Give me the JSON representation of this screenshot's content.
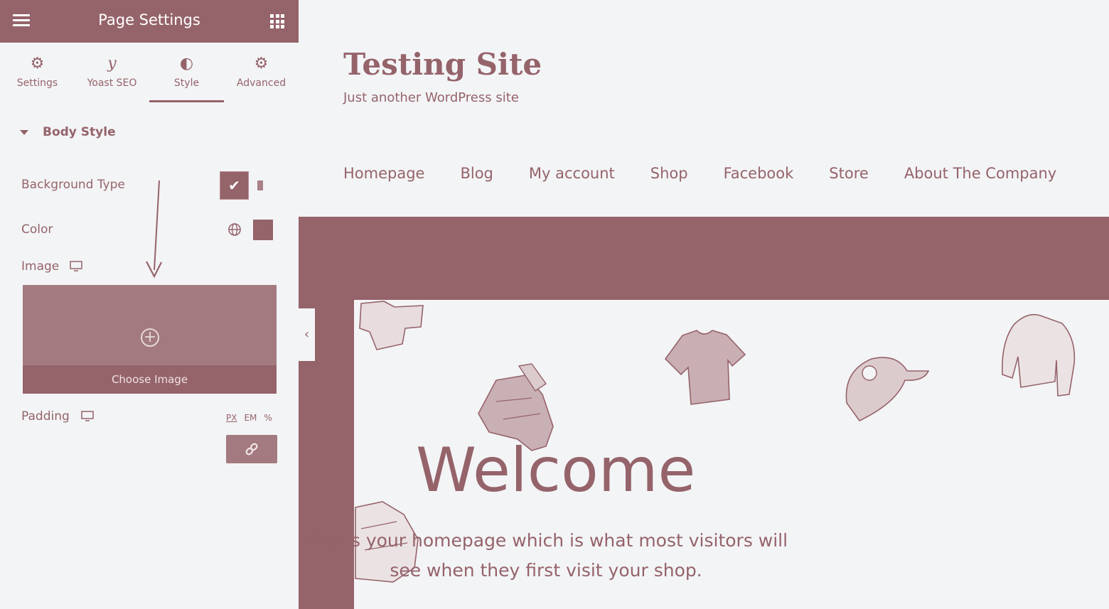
{
  "panel": {
    "title": "Page Settings",
    "tabs": [
      {
        "label": "Settings",
        "icon": "gear-icon"
      },
      {
        "label": "Yoast SEO",
        "icon": "yoast-icon"
      },
      {
        "label": "Style",
        "icon": "contrast-icon",
        "active": true
      },
      {
        "label": "Advanced",
        "icon": "gear-icon"
      }
    ],
    "section_title": "Body Style",
    "background_type_label": "Background Type",
    "color_label": "Color",
    "image_label": "Image",
    "choose_image_label": "Choose Image",
    "padding_label": "Padding",
    "units": [
      "PX",
      "EM",
      "%"
    ],
    "selected_unit": "PX"
  },
  "site": {
    "title": "Testing Site",
    "tagline": "Just another WordPress site",
    "nav": [
      "Homepage",
      "Blog",
      "My account",
      "Shop",
      "Facebook",
      "Store",
      "About The Company"
    ],
    "welcome_title": "Welcome",
    "welcome_text": "This is your homepage which is what most visitors will see when they first visit your shop."
  },
  "colors": {
    "accent": "#95636a",
    "background": "#f3f4f6"
  }
}
